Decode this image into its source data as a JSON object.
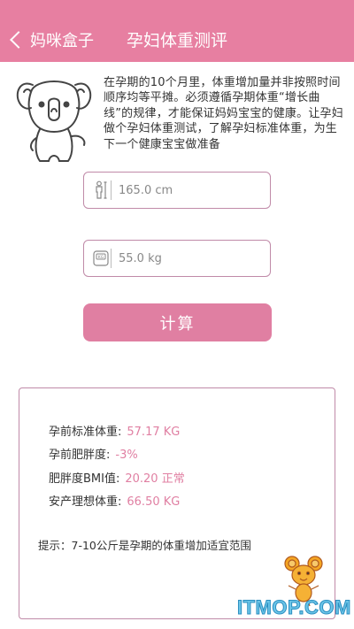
{
  "nav": {
    "back_label": "妈咪盒子",
    "title": "孕妇体重测评"
  },
  "intro": {
    "text": "在孕期的10个月里，体重增加量并非按照时间顺序均等平摊。必须遵循孕期体重“增长曲线”的规律，才能保证妈妈宝宝的健康。让孕妇做个孕妇体重测试，了解孕妇标准体重，为生下一个健康宝宝做准备"
  },
  "form": {
    "height_value": "165.0 cm",
    "weight_value": "55.0 kg",
    "calculate_label": "计算"
  },
  "results": {
    "rows": [
      {
        "label": "孕前标准体重:",
        "value": "57.17 KG"
      },
      {
        "label": "孕前肥胖度:",
        "value": "-3%"
      },
      {
        "label": "肥胖度BMI值:",
        "value": "20.20 正常"
      },
      {
        "label": "安产理想体重:",
        "value": "66.50 KG"
      }
    ],
    "tip": "提示：7-10公斤是孕期的体重增加适宜范围"
  },
  "watermark": "ITMOP.COM",
  "colors": {
    "nav_bg": "#e77fa1",
    "accent": "#e07fa2",
    "border": "#c08aa8"
  },
  "icons": {
    "back": "chevron-left-icon",
    "height": "person-height-icon",
    "weight": "scale-kg-icon"
  }
}
